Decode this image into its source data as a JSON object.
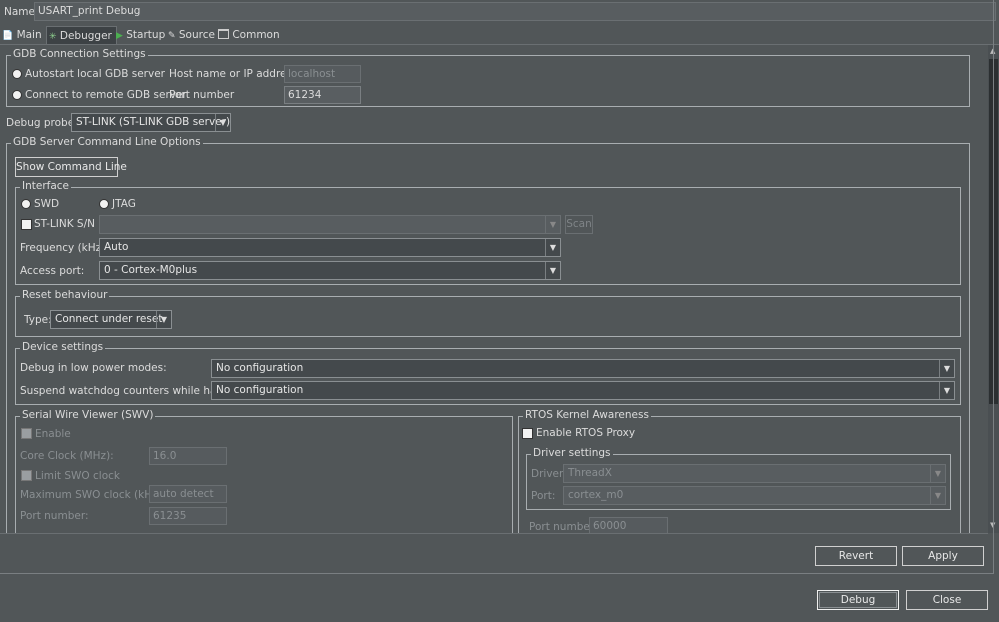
{
  "name": {
    "label": "Name:",
    "value": "USART_print Debug"
  },
  "tabs": [
    {
      "label": "Main",
      "icon": "page-icon"
    },
    {
      "label": "Debugger",
      "icon": "bug-icon"
    },
    {
      "label": "Startup",
      "icon": "play-icon"
    },
    {
      "label": "Source",
      "icon": "source-icon"
    },
    {
      "label": "Common",
      "icon": "window-icon"
    }
  ],
  "gdb_connection": {
    "title": "GDB Connection Settings",
    "autostart_label": "Autostart local GDB server",
    "remote_label": "Connect to remote GDB server",
    "host_label": "Host name or IP address",
    "host_value": "localhost",
    "port_label": "Port number",
    "port_value": "61234"
  },
  "debug_probe": {
    "label": "Debug probe",
    "value": "ST-LINK (ST-LINK GDB server)"
  },
  "server_options": {
    "title": "GDB Server Command Line Options",
    "show_cmd_label": "Show Command Line",
    "interface": {
      "title": "Interface",
      "swd_label": "SWD",
      "jtag_label": "JTAG",
      "stlink_sn_label": "ST-LINK S/N",
      "stlink_sn_value": "",
      "scan_label": "Scan",
      "freq_label": "Frequency (kHz):",
      "freq_value": "Auto",
      "access_port_label": "Access port:",
      "access_port_value": "0 - Cortex-M0plus"
    },
    "reset": {
      "title": "Reset behaviour",
      "type_label": "Type:",
      "type_value": "Connect under reset"
    },
    "device": {
      "title": "Device settings",
      "low_power_label": "Debug in low power modes:",
      "low_power_value": "No configuration",
      "watchdog_label": "Suspend watchdog counters while halted:",
      "watchdog_value": "No configuration"
    },
    "swv": {
      "title": "Serial Wire Viewer (SWV)",
      "enable_label": "Enable",
      "core_clock_label": "Core Clock (MHz):",
      "core_clock_value": "16.0",
      "limit_swo_label": "Limit SWO clock",
      "max_swo_label": "Maximum SWO clock (kHz):",
      "max_swo_value": "auto detect",
      "port_label": "Port number:",
      "port_value": "61235"
    },
    "rtos": {
      "title": "RTOS Kernel Awareness",
      "enable_label": "Enable RTOS Proxy",
      "driver_title": "Driver settings",
      "driver_label": "Driver:",
      "driver_value": "ThreadX",
      "port_label": "Port:",
      "port_value": "cortex_m0",
      "port_number_label": "Port number:",
      "port_number_value": "60000"
    }
  },
  "footer": {
    "revert_label": "Revert",
    "apply_label": "Apply",
    "debug_label": "Debug",
    "close_label": "Close"
  }
}
